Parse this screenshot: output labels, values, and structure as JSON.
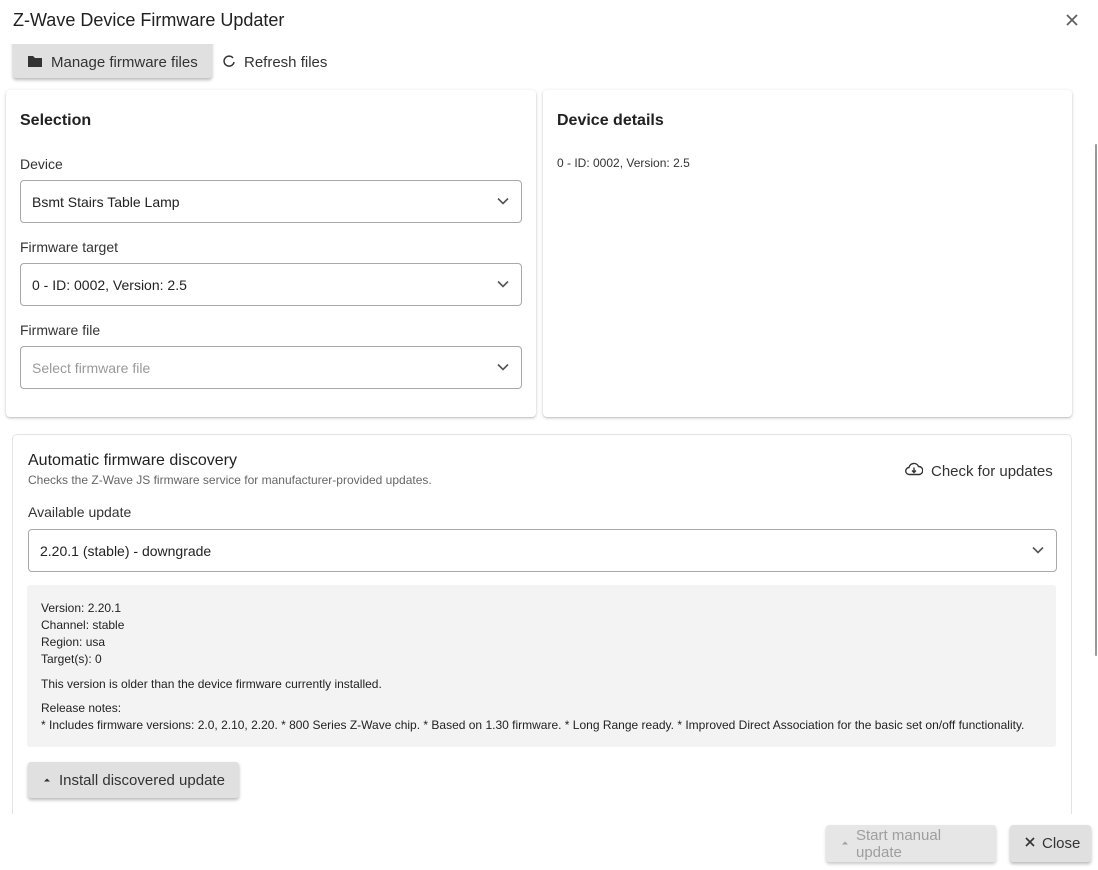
{
  "dialog": {
    "title": "Z-Wave Device Firmware Updater",
    "close_icon": "close-icon"
  },
  "toolbar": {
    "manage_label": "Manage firmware files",
    "manage_icon": "folder-icon",
    "refresh_label": "Refresh files",
    "refresh_icon": "refresh-icon"
  },
  "selection": {
    "title": "Selection",
    "device_label": "Device",
    "device_value": "Bsmt Stairs Table Lamp",
    "target_label": "Firmware target",
    "target_value": "0 - ID: 0002, Version: 2.5",
    "file_label": "Firmware file",
    "file_placeholder": "Select firmware file"
  },
  "details": {
    "title": "Device details",
    "text": "0 - ID: 0002, Version: 2.5"
  },
  "discovery": {
    "title": "Automatic firmware discovery",
    "subtitle": "Checks the Z-Wave JS firmware service for manufacturer-provided updates.",
    "check_label": "Check for updates",
    "check_icon": "cloud-download-icon",
    "available_label": "Available update",
    "available_value": "2.20.1 (stable) - downgrade",
    "info": {
      "version": "Version: 2.20.1",
      "channel": "Channel: stable",
      "region": "Region: usa",
      "targets": "Target(s): 0",
      "warning": "This version is older than the device firmware currently installed.",
      "notes_label": "Release notes:",
      "notes_text": "* Includes firmware versions: 2.0, 2.10, 2.20. * 800 Series Z-Wave chip. * Based on 1.30 firmware. * Long Range ready. * Improved Direct Association for the basic set on/off functionality."
    },
    "install_label": "Install discovered update",
    "install_icon": "upload-icon"
  },
  "footer": {
    "start_label": "Start manual update",
    "start_icon": "upload-icon",
    "close_label": "Close",
    "close_icon": "close-icon"
  },
  "colors": {
    "warning": "#d97a00",
    "disabled_text": "#9e9e9e",
    "button_bg": "#e0e0e0"
  }
}
